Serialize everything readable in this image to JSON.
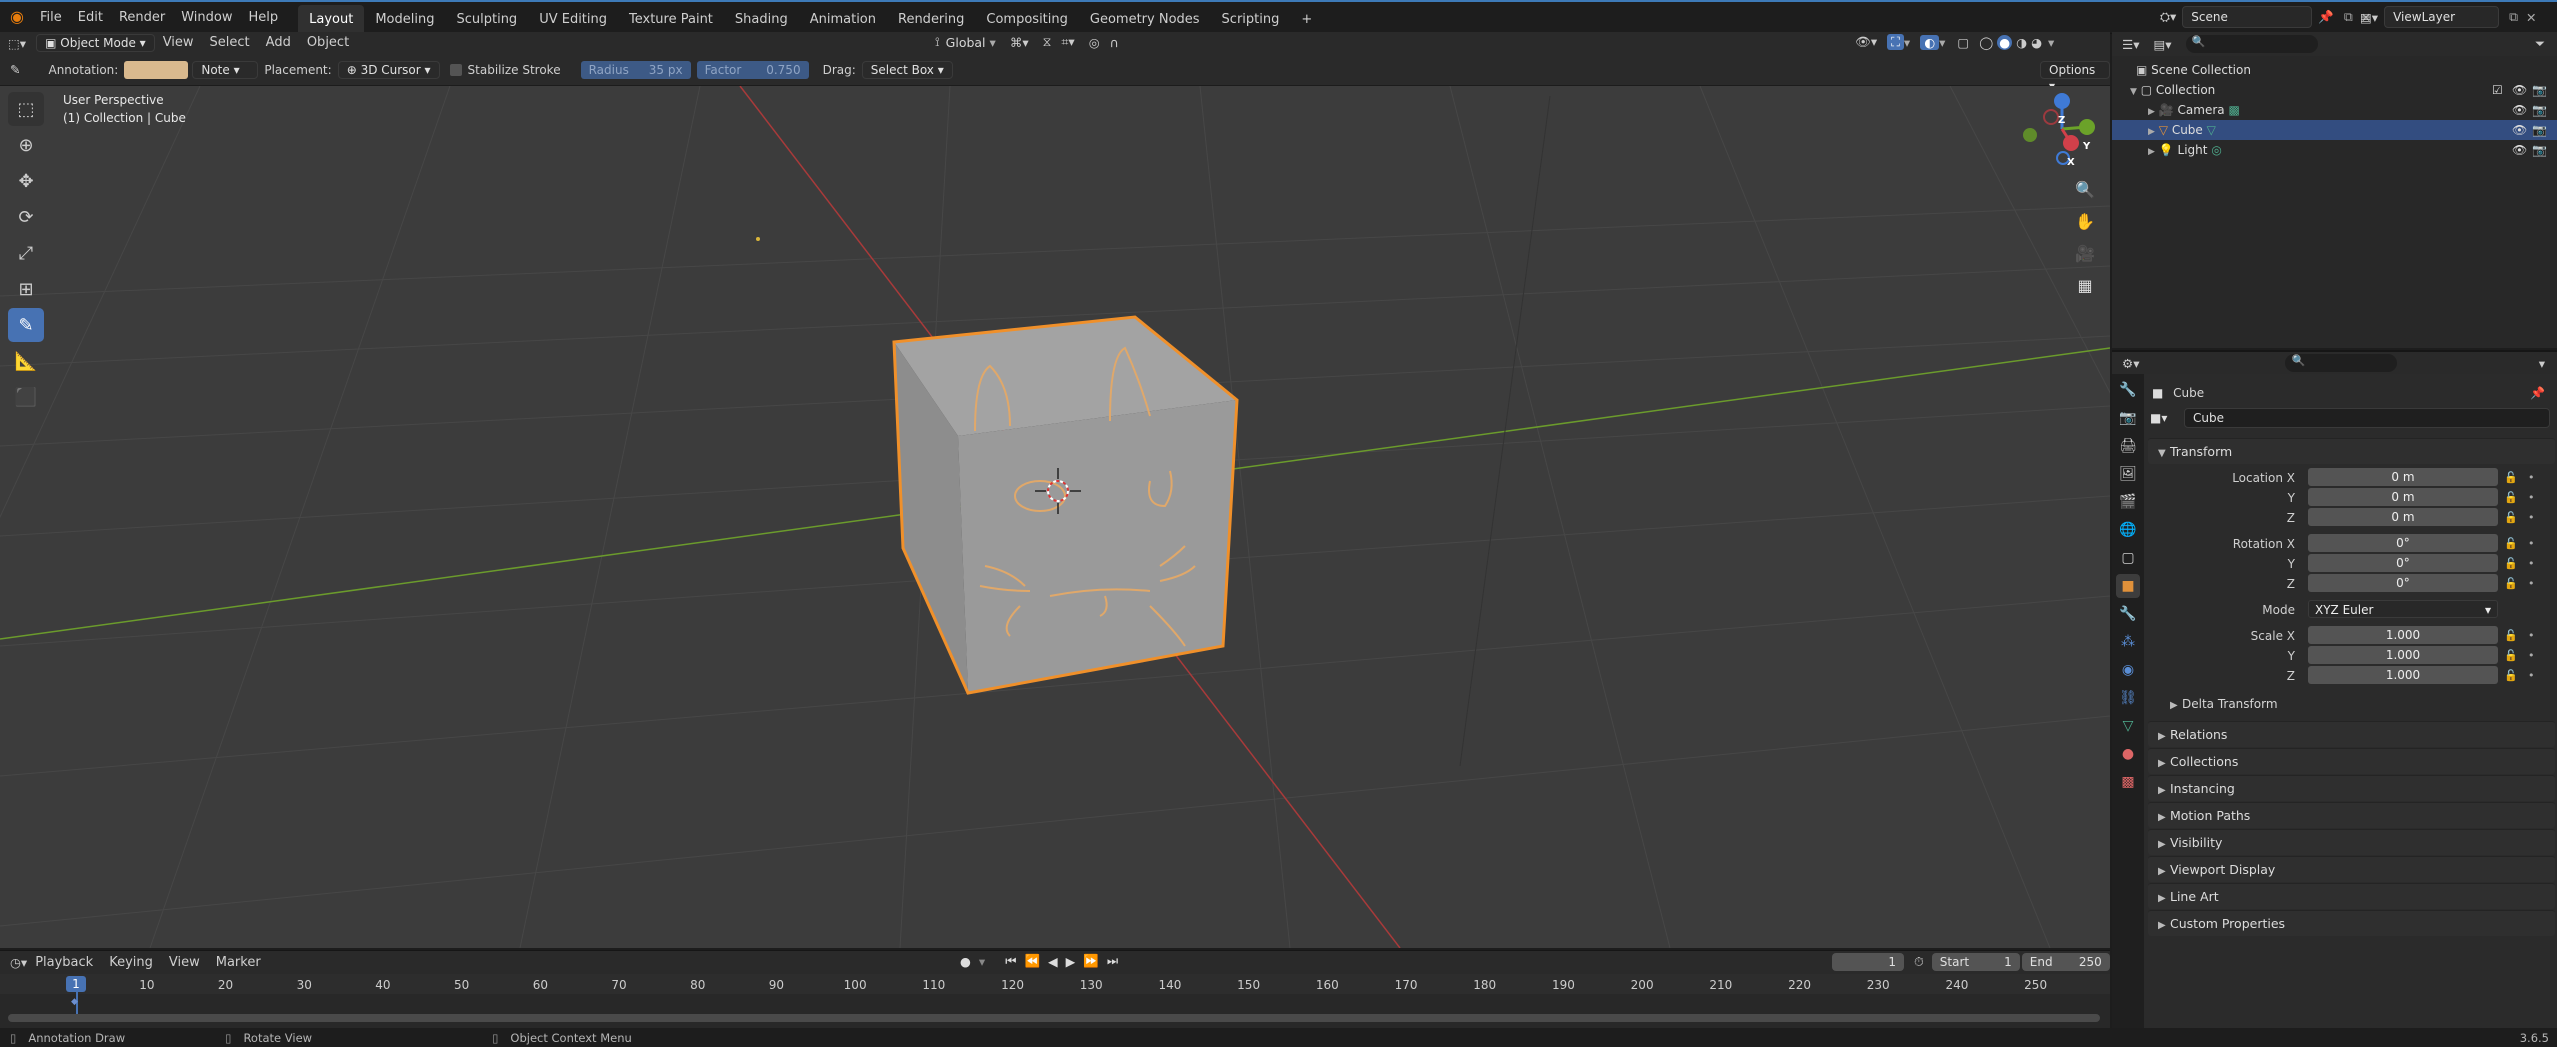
{
  "topbar": {
    "menus": [
      "File",
      "Edit",
      "Render",
      "Window",
      "Help"
    ],
    "workspaces": [
      "Layout",
      "Modeling",
      "Sculpting",
      "UV Editing",
      "Texture Paint",
      "Shading",
      "Animation",
      "Rendering",
      "Compositing",
      "Geometry Nodes",
      "Scripting"
    ],
    "active_workspace": "Layout",
    "add_tab": "+",
    "scene": "Scene",
    "view_layer": "ViewLayer"
  },
  "viewport_header": {
    "mode": "Object Mode",
    "menus": [
      "View",
      "Select",
      "Add",
      "Object"
    ],
    "orientation": "Global"
  },
  "tool_settings": {
    "annotation_label": "Annotation:",
    "annotation_color": "#d9b98e",
    "layer": "Note",
    "placement_label": "Placement:",
    "placement": "3D Cursor",
    "stabilize": "Stabilize Stroke",
    "radius_label": "Radius",
    "radius_value": "35 px",
    "factor_label": "Factor",
    "factor_value": "0.750",
    "drag_label": "Drag:",
    "drag": "Select Box",
    "options": "Options"
  },
  "viewport": {
    "perspective": "User Perspective",
    "context": "(1) Collection | Cube",
    "gizmo": {
      "x": "X",
      "y": "Y",
      "z": "Z"
    }
  },
  "timeline": {
    "menus": [
      "Playback",
      "Keying",
      "View",
      "Marker"
    ],
    "current_frame": "1",
    "start_label": "Start",
    "start": "1",
    "end_label": "End",
    "end": "250",
    "frame_marker": "1",
    "ticks": [
      "10",
      "20",
      "30",
      "40",
      "50",
      "60",
      "70",
      "80",
      "90",
      "100",
      "110",
      "120",
      "130",
      "140",
      "150",
      "160",
      "170",
      "180",
      "190",
      "200",
      "210",
      "220",
      "230",
      "240",
      "250"
    ]
  },
  "statusbar": {
    "left": "Annotation Draw",
    "middle": "Rotate View",
    "right": "Object Context Menu",
    "version": "3.6.5"
  },
  "outliner": {
    "root": "Scene Collection",
    "collection": "Collection",
    "items": [
      {
        "name": "Camera",
        "selected": false
      },
      {
        "name": "Cube",
        "selected": true
      },
      {
        "name": "Light",
        "selected": false
      }
    ]
  },
  "properties": {
    "object_name": "Cube",
    "data_name": "Cube",
    "transform": "Transform",
    "location_label": "Location X",
    "location": [
      "0 m",
      "0 m",
      "0 m"
    ],
    "rotation_label": "Rotation X",
    "rotation": [
      "0°",
      "0°",
      "0°"
    ],
    "mode_label": "Mode",
    "mode": "XYZ Euler",
    "scale_label": "Scale X",
    "scale": [
      "1.000",
      "1.000",
      "1.000"
    ],
    "axis_y": "Y",
    "axis_z": "Z",
    "delta": "Delta Transform",
    "panels": [
      "Relations",
      "Collections",
      "Instancing",
      "Motion Paths",
      "Visibility",
      "Viewport Display",
      "Line Art",
      "Custom Properties"
    ]
  }
}
